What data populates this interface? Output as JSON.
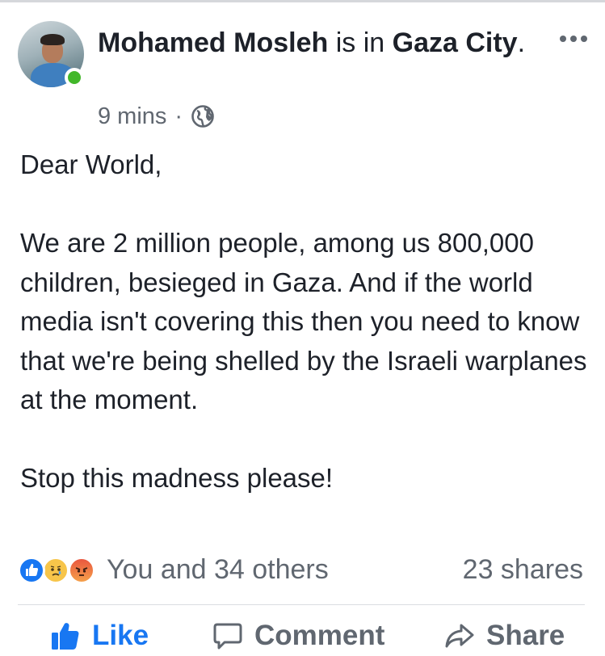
{
  "post": {
    "author": "Mohamed Mosleh",
    "location_prefix": "is in",
    "location": "Gaza City",
    "location_suffix": ".",
    "time": "9 mins",
    "separator": "·",
    "privacy_icon": "globe-icon",
    "more_icon": "more-options-icon",
    "text": "Dear World,\n\nWe are 2 million people, among us 800,000 children, besieged in Gaza. And if the world media isn't covering this then you need to know that we're being shelled by the Israeli warplanes at the moment.\n\nStop this madness please!"
  },
  "reactions": {
    "icons": [
      "like-reaction-icon",
      "sad-reaction-icon",
      "angry-reaction-icon"
    ],
    "summary": "You and 34 others",
    "shares": "23 shares"
  },
  "actions": {
    "like": "Like",
    "comment": "Comment",
    "share": "Share"
  },
  "colors": {
    "accent": "#1877f2",
    "online": "#42b72a",
    "muted_text": "#606770"
  }
}
